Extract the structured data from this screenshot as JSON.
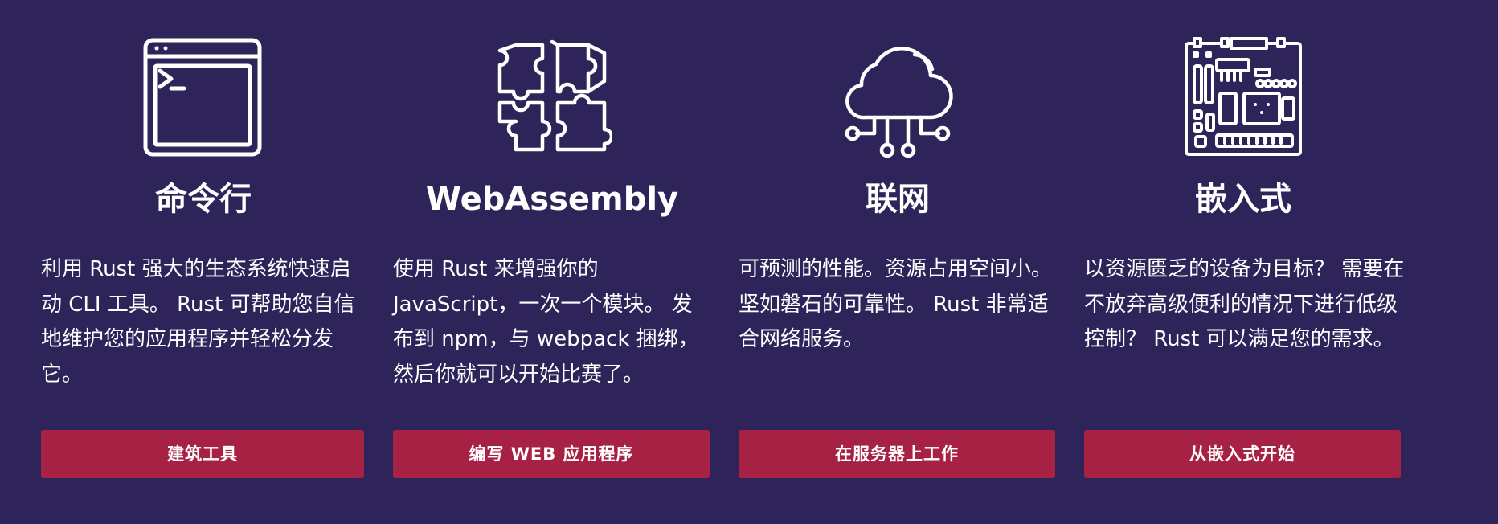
{
  "features": [
    {
      "icon": "terminal-window-icon",
      "title": "命令行",
      "description": "利用 Rust 强大的生态系统快速启动 CLI 工具。 Rust 可帮助您自信地维护您的应用程序并轻松分发它。",
      "button_label": "建筑工具"
    },
    {
      "icon": "puzzle-pieces-icon",
      "title": "WebAssembly",
      "description": "使用 Rust 来增强你的 JavaScript，一次一个模块。 发布到 npm，与 webpack 捆绑，然后你就可以开始比赛了。",
      "button_label": "编写 WEB 应用程序"
    },
    {
      "icon": "cloud-network-icon",
      "title": "联网",
      "description": "可预测的性能。资源占用空间小。坚如磐石的可靠性。 Rust 非常适合网络服务。",
      "button_label": "在服务器上工作"
    },
    {
      "icon": "circuit-board-icon",
      "title": "嵌入式",
      "description": "以资源匮乏的设备为目标？ 需要在不放弃高级便利的情况下进行低级控制？ Rust 可以满足您的需求。",
      "button_label": "从嵌入式开始"
    }
  ],
  "colors": {
    "background": "#2e2459",
    "button": "#a72145",
    "text": "#ffffff"
  }
}
